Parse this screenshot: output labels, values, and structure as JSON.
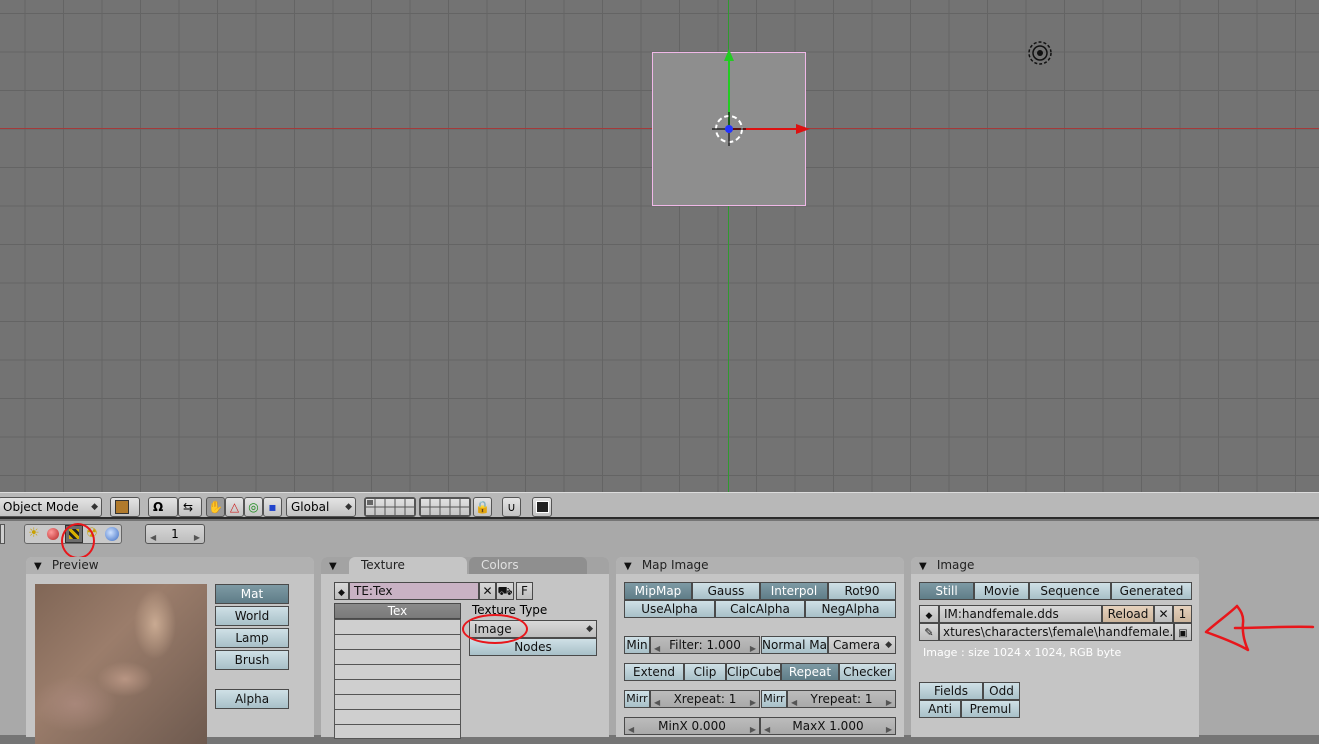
{
  "header": {
    "mode": "Object Mode",
    "orientation": "Global",
    "frame": "1"
  },
  "preview": {
    "title": "Preview",
    "buttons": [
      "Mat",
      "World",
      "Lamp",
      "Brush"
    ],
    "alpha": "Alpha"
  },
  "texture": {
    "tab_active": "Texture",
    "tab_inactive": "Colors",
    "name": "TE:Tex",
    "fake_user": "F",
    "channel_header": "Tex",
    "type_label": "Texture Type",
    "type_value": "Image",
    "nodes": "Nodes"
  },
  "map_image": {
    "title": "Map Image",
    "row1": [
      "MipMap",
      "Gauss",
      "Interpol",
      "Rot90"
    ],
    "row2": [
      "UseAlpha",
      "CalcAlpha",
      "NegAlpha"
    ],
    "min": "Min",
    "filter": "Filter: 1.000",
    "normal_map": "Normal Ma",
    "space": "Camera",
    "extend_row": [
      "Extend",
      "Clip",
      "ClipCube",
      "Repeat",
      "Checker"
    ],
    "mirr": "Mirr",
    "xrepeat": "Xrepeat: 1",
    "yrepeat": "Yrepeat: 1",
    "minx": "MinX 0.000",
    "maxx": "MaxX 1.000"
  },
  "image": {
    "title": "Image",
    "source_tabs": [
      "Still",
      "Movie",
      "Sequence",
      "Generated"
    ],
    "name": "IM:handfemale.dds",
    "reload": "Reload",
    "users": "1",
    "path": "xtures\\characters\\female\\handfemale.dds",
    "info": "Image : size 1024 x 1024, RGB byte",
    "fields": "Fields",
    "odd": "Odd",
    "anti": "Anti",
    "premul": "Premul"
  },
  "colors": {
    "annotation": "#e8161b",
    "axis_x": "#a43a3a",
    "axis_y": "#2f9a2f"
  }
}
